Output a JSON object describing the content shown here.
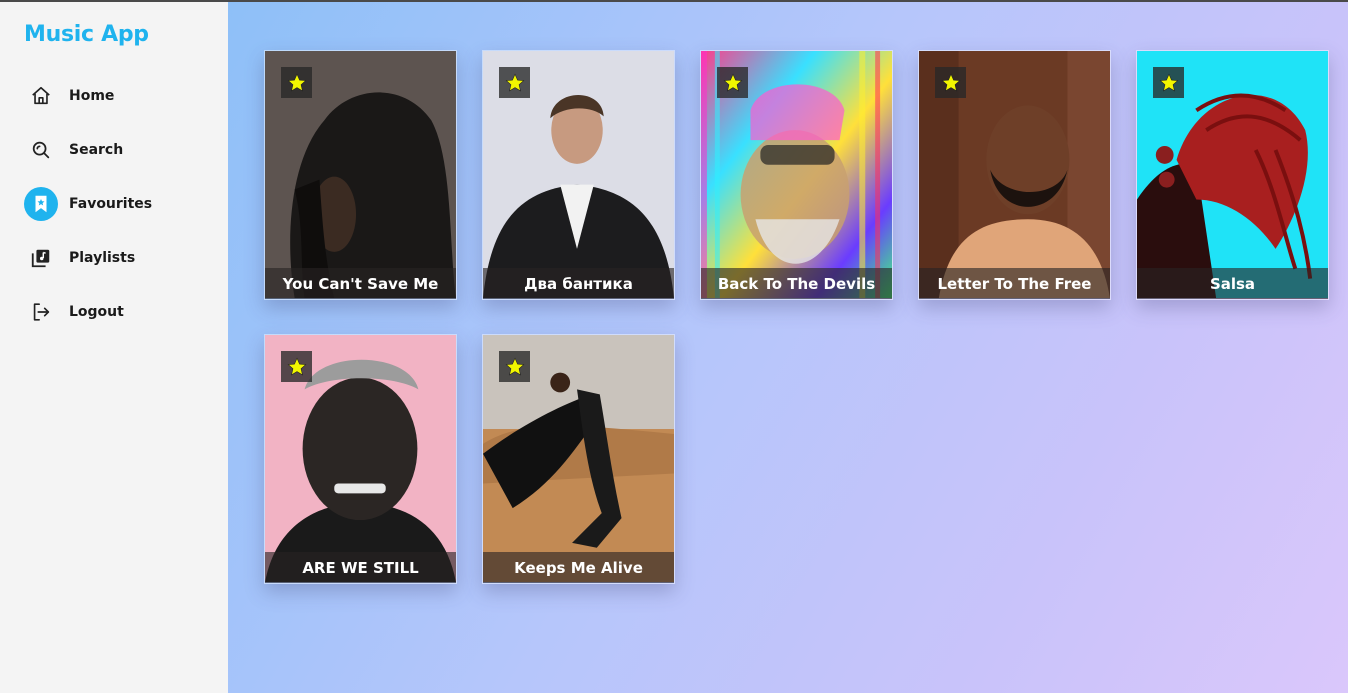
{
  "app": {
    "title": "Music App"
  },
  "nav": {
    "items": [
      {
        "label": "Home",
        "icon": "home-icon"
      },
      {
        "label": "Search",
        "icon": "search-icon"
      },
      {
        "label": "Favourites",
        "icon": "bookmark-star-icon",
        "active": true
      },
      {
        "label": "Playlists",
        "icon": "playlist-icon"
      },
      {
        "label": "Logout",
        "icon": "logout-icon"
      }
    ]
  },
  "colors": {
    "brand": "#1fb3ee",
    "favourite_star": "#f2f600",
    "active_nav": "#1fb3ee"
  },
  "favourites": {
    "cards": [
      {
        "title": "You Can't Save Me",
        "favourited": true
      },
      {
        "title": "Два бантика",
        "favourited": true
      },
      {
        "title": "Back To The Devils",
        "favourited": true
      },
      {
        "title": "Letter To The Free",
        "favourited": true
      },
      {
        "title": "Salsa",
        "favourited": true
      },
      {
        "title": "ARE WE STILL",
        "favourited": true
      },
      {
        "title": "Keeps Me Alive",
        "favourited": true
      }
    ]
  }
}
